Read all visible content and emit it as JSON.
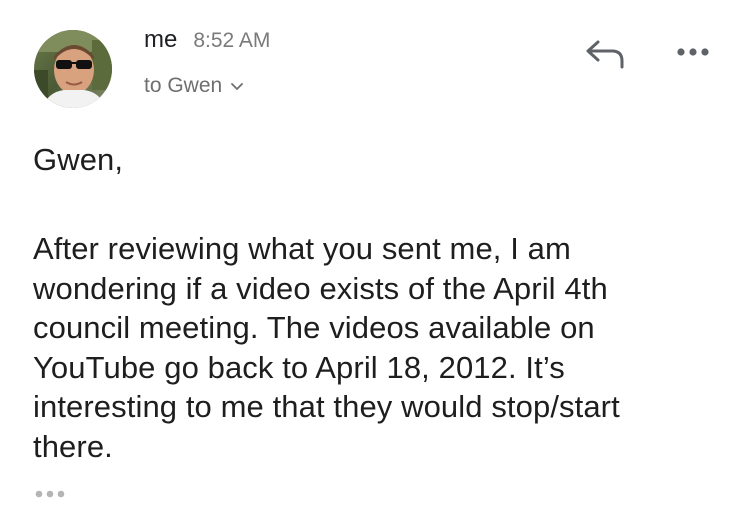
{
  "email": {
    "sender_name": "me",
    "time": "8:52 AM",
    "recipient": "to Gwen",
    "greeting": "Gwen,",
    "body_lines": [
      "After reviewing what you sent me, I am",
      "wondering if a video exists of the April 4th",
      "council meeting. The videos available on",
      "YouTube go back to April 18, 2012. It’s",
      "interesting to me that they would stop/start",
      "there."
    ]
  },
  "icons": {
    "reply": "reply-arrow-icon",
    "more": "more-horizontal-icon",
    "chevron": "chevron-down-icon",
    "quoted": "show-trimmed-content-icon"
  },
  "colors": {
    "text": "#1e1e1e",
    "secondary_text": "#7a7a7a",
    "icon": "#5f6368"
  }
}
